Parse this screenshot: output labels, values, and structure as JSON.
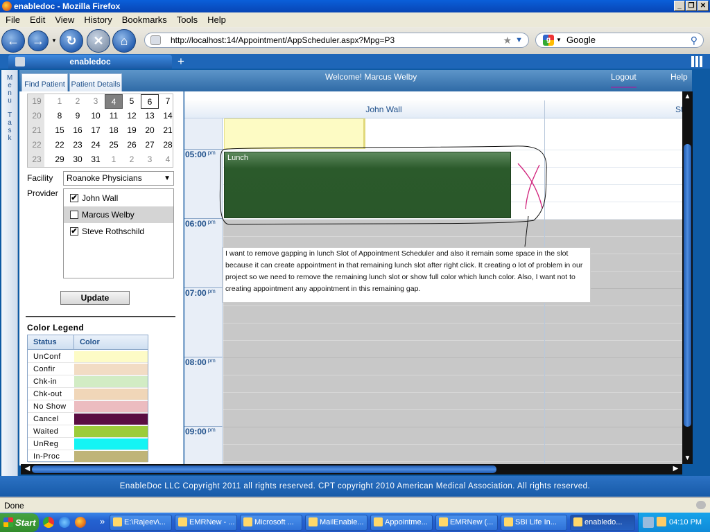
{
  "window": {
    "title": "enabledoc - Mozilla Firefox"
  },
  "menu": [
    "File",
    "Edit",
    "View",
    "History",
    "Bookmarks",
    "Tools",
    "Help"
  ],
  "address": {
    "url": "http://localhost:14/Appointment/AppScheduler.aspx?Mpg=P3"
  },
  "search": {
    "engine": "Google"
  },
  "tab": {
    "label": "enabledoc",
    "new_tab": "+"
  },
  "app": {
    "side_menu": "Menu",
    "side_task": "Task",
    "welcome": "Welcome! Marcus Welby",
    "logout": "Logout",
    "help": "Help",
    "tabs": [
      "Find Patient",
      "Patient Details"
    ]
  },
  "calendar": {
    "rows": [
      [
        "19",
        "1",
        "2",
        "3",
        "4",
        "5",
        "6",
        "7"
      ],
      [
        "20",
        "8",
        "9",
        "10",
        "11",
        "12",
        "13",
        "14"
      ],
      [
        "21",
        "15",
        "16",
        "17",
        "18",
        "19",
        "20",
        "21"
      ],
      [
        "22",
        "22",
        "23",
        "24",
        "25",
        "26",
        "27",
        "28"
      ],
      [
        "23",
        "29",
        "30",
        "31",
        "1",
        "2",
        "3",
        "4"
      ]
    ],
    "selected": "4",
    "today": "6"
  },
  "filters": {
    "facility_label": "Facility",
    "facility_value": "Roanoke Physicians",
    "provider_label": "Provider",
    "providers": [
      {
        "name": "John Wall",
        "checked": "✔"
      },
      {
        "name": "Marcus Welby",
        "checked": ""
      },
      {
        "name": "Steve Rothschild",
        "checked": "✔"
      }
    ],
    "update_label": "Update"
  },
  "legend": {
    "title": "Color Legend",
    "col_status": "Status",
    "col_color": "Color",
    "items": [
      {
        "status": "UnConf",
        "color": "#fdfbc6"
      },
      {
        "status": "Confir",
        "color": "#f2dcc4"
      },
      {
        "status": "Chk-in",
        "color": "#d2ecc4"
      },
      {
        "status": "Chk-out",
        "color": "#f0d6b8"
      },
      {
        "status": "No Show",
        "color": "#ecbcc0"
      },
      {
        "status": "Cancel",
        "color": "#5a0d42"
      },
      {
        "status": "Waited",
        "color": "#9ccc3a"
      },
      {
        "status": "UnReg",
        "color": "#14f4f4"
      },
      {
        "status": "In-Proc",
        "color": "#bfb478"
      }
    ]
  },
  "scheduler": {
    "columns": [
      "John Wall",
      "St"
    ],
    "times": [
      {
        "hour": "05:00",
        "ampm": "pm"
      },
      {
        "hour": "06:00",
        "ampm": "pm"
      },
      {
        "hour": "07:00",
        "ampm": "pm"
      },
      {
        "hour": "08:00",
        "ampm": "pm"
      },
      {
        "hour": "09:00",
        "ampm": "pm"
      }
    ],
    "lunch_label": "Lunch",
    "note": "I want to remove gapping in lunch Slot of Appointment Scheduler and also it remain some space in the slot because it can create appointment in that remaining lunch slot after right click. It creating o lot of problem in our project so we need to remove the remaining lunch slot or show full color which lunch color. Also, I want not to creating appointment any appointment in this remaining gap."
  },
  "footer": "EnableDoc LLC Copyright 2011 all rights reserved. CPT copyright 2010 American Medical Association. All rights reserved.",
  "status": "Done",
  "taskbar": {
    "start": "Start",
    "tasks": [
      "E:\\Rajeev\\...",
      "EMRNew - ...",
      "Microsoft ...",
      "MailEnable...",
      "Appointme...",
      "EMRNew (...",
      "SBI Life In...",
      "enabledo..."
    ],
    "clock": "04:10 PM"
  }
}
